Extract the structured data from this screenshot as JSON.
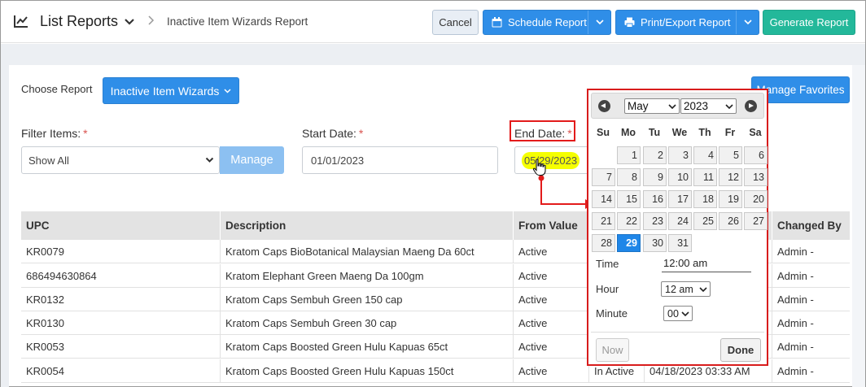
{
  "header": {
    "title": "List Reports",
    "breadcrumb": "Inactive Item Wizards Report",
    "cancel_label": "Cancel",
    "schedule_label": "Schedule Report",
    "print_label": "Print/Export Report",
    "generate_label": "Generate Report"
  },
  "choose": {
    "label": "Choose Report",
    "button_label": "Inactive Item Wizards",
    "favorites_label": "Manage Favorites"
  },
  "filters": {
    "filter_items_label": "Filter Items:",
    "filter_items_value": "Show All",
    "manage_label": "Manage",
    "start_date_label": "Start Date:",
    "start_date_value": "01/01/2023",
    "end_date_label": "End Date:",
    "end_date_value": "05/29/2023",
    "required_mark": "*"
  },
  "table": {
    "headers": [
      "UPC",
      "Description",
      "From Value",
      "",
      "",
      "Changed By"
    ],
    "rows": [
      [
        "KR0079",
        "Kratom Caps BioBotanical Malaysian Maeng Da 60ct",
        "Active",
        "",
        "",
        "Admin -"
      ],
      [
        "686494630864",
        "Kratom Elephant Green Maeng Da 100gm",
        "Active",
        "",
        "",
        "Admin -"
      ],
      [
        "KR0132",
        "Kratom Caps Sembuh Green 150 cap",
        "Active",
        "",
        "",
        "Admin -"
      ],
      [
        "KR0130",
        "Kratom Caps Sembuh Green 30 cap",
        "Active",
        "",
        "",
        "Admin -"
      ],
      [
        "KR0053",
        "Kratom Caps Boosted Green Hulu Kapuas 65ct",
        "Active",
        "",
        "",
        "Admin -"
      ],
      [
        "KR0054",
        "Kratom Caps Boosted Green Hulu Kapuas 150ct",
        "Active",
        "In Active",
        "04/18/2023 03:33 AM",
        "Admin -"
      ]
    ]
  },
  "datepicker": {
    "month": "May",
    "year": "2023",
    "weekdays": [
      "Su",
      "Mo",
      "Tu",
      "We",
      "Th",
      "Fr",
      "Sa"
    ],
    "weeks": [
      [
        "",
        "1",
        "2",
        "3",
        "4",
        "5",
        "6"
      ],
      [
        "7",
        "8",
        "9",
        "10",
        "11",
        "12",
        "13"
      ],
      [
        "14",
        "15",
        "16",
        "17",
        "18",
        "19",
        "20"
      ],
      [
        "21",
        "22",
        "23",
        "24",
        "25",
        "26",
        "27"
      ],
      [
        "28",
        "29",
        "30",
        "31",
        "",
        "",
        ""
      ]
    ],
    "selected_day": "29",
    "time_label": "Time",
    "time_value": "12:00 am",
    "hour_label": "Hour",
    "hour_value": "12 am",
    "minute_label": "Minute",
    "minute_value": "00",
    "now_label": "Now",
    "done_label": "Done"
  },
  "colors": {
    "primary": "#2f8ee8",
    "generate": "#23b89a",
    "highlight": "#f5ff00",
    "annotation": "#e31b1b",
    "required": "#d9534f"
  }
}
